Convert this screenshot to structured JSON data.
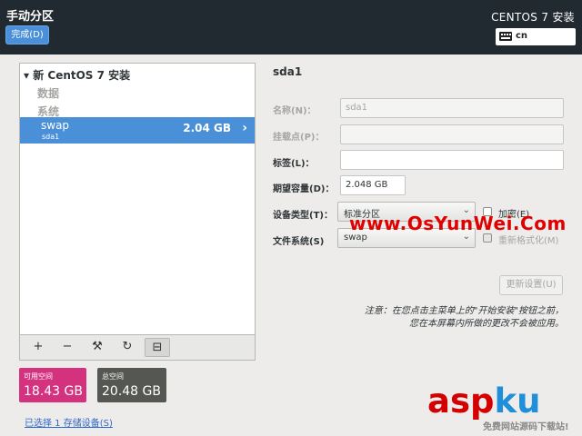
{
  "header": {
    "title": "手动分区",
    "done_label": "完成(D)",
    "product": "CENTOS 7 安装",
    "keyboard_layout": "cn"
  },
  "tree": {
    "title": "新 CentOS 7 安装",
    "groups": [
      "数据",
      "系统"
    ],
    "selected": {
      "name": "swap",
      "device": "sda1",
      "size": "2.04 GB"
    }
  },
  "toolbar": {
    "buttons": [
      {
        "name": "add-button",
        "symbol": "+"
      },
      {
        "name": "remove-button",
        "symbol": "−"
      },
      {
        "name": "configure-button",
        "symbol": "⚒"
      },
      {
        "name": "refresh-button",
        "symbol": "↻"
      },
      {
        "name": "reset-button",
        "symbol": "⊟"
      }
    ]
  },
  "space": {
    "available_label": "可用空间",
    "available_value": "18.43 GB",
    "available_color": "#d4317e",
    "total_label": "总空间",
    "total_value": "20.48 GB",
    "total_color": "#555753"
  },
  "storage_link": "已选择 1 存储设备(S)",
  "detail": {
    "title": "sda1",
    "name_label": "名称(N)：",
    "name_value": "sda1",
    "mount_label": "挂载点(P)：",
    "mount_value": "",
    "tag_label": "标签(L)：",
    "tag_value": "",
    "capacity_label": "期望容量(D)：",
    "capacity_value": "2.048 GB",
    "device_type_label": "设备类型(T)：",
    "device_type_value": "标准分区",
    "encrypt_label": "加密(E)",
    "fs_label": "文件系统(S)",
    "fs_value": "swap",
    "reformat_label": "重新格式化(M)",
    "update_label": "更新设置(U)",
    "note_line1": "注意：在您点击主菜单上的\"开始安装\"按钮之前，",
    "note_line2": "您在本屏幕内所做的更改不会被应用。"
  },
  "watermarks": {
    "site1": "www.OsYunWei.Com",
    "brand_a": "asp",
    "brand_k": "ku",
    "brand_sub": "免费网站源码下载站!"
  }
}
